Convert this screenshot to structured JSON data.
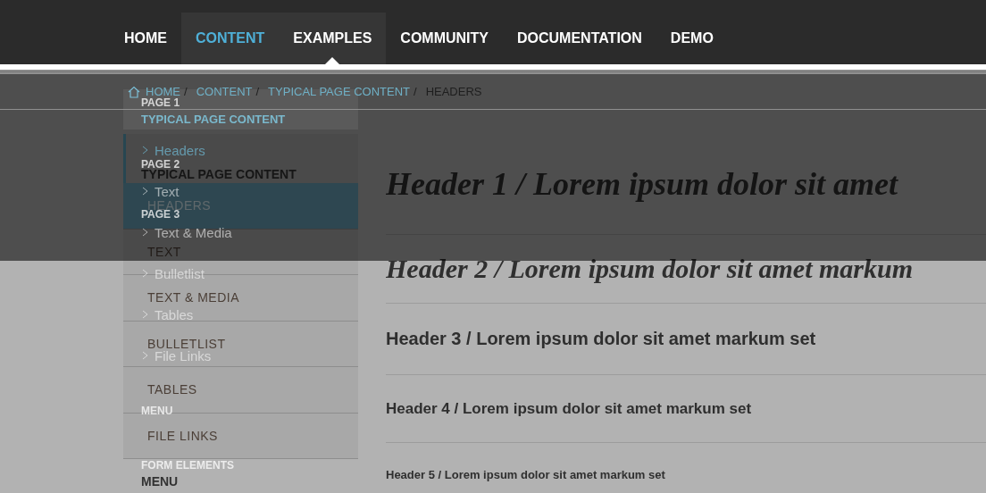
{
  "nav": [
    {
      "label": "HOME",
      "selected": false,
      "expanded": false
    },
    {
      "label": "CONTENT",
      "selected": true,
      "expanded": false
    },
    {
      "label": "EXAMPLES",
      "selected": false,
      "expanded": true
    },
    {
      "label": "COMMUNITY",
      "selected": false,
      "expanded": false
    },
    {
      "label": "DOCUMENTATION",
      "selected": false,
      "expanded": false
    },
    {
      "label": "DEMO",
      "selected": false,
      "expanded": false
    }
  ],
  "breadcrumb": [
    {
      "label": "HOME",
      "selected": false,
      "separator": "/"
    },
    {
      "label": "CONTENT",
      "selected": false,
      "separator": "/"
    },
    {
      "label": "TYPICAL PAGE CONTENT",
      "selected": false,
      "separator": "/"
    },
    {
      "label": "HEADERS",
      "selected": true
    }
  ],
  "sidebar": {
    "title": "TYPICAL PAGE CONTENT",
    "items": [
      {
        "label": "HEADERS",
        "selected": true
      },
      {
        "label": "TEXT",
        "selected": false
      },
      {
        "label": "TEXT & MEDIA",
        "selected": false
      },
      {
        "label": "BULLETLIST",
        "selected": false
      },
      {
        "label": "TABLES",
        "selected": false
      },
      {
        "label": "FILE LINKS",
        "selected": false
      }
    ],
    "footer": "MENU"
  },
  "headers": [
    {
      "kind": "h1",
      "text": "Header 1 / Lorem ipsum dolor sit amet"
    },
    {
      "kind": "h2",
      "text": "Header 2 / Lorem ipsum dolor sit amet markum"
    },
    {
      "kind": "h3",
      "text": "Header 3 / Lorem ipsum dolor sit amet markum set"
    },
    {
      "kind": "h4",
      "text": "Header 4 / Lorem ipsum dolor sit amet markum set"
    },
    {
      "kind": "h5",
      "text": "Header 5 / Lorem ipsum dolor sit amet markum set"
    }
  ],
  "dropdown": {
    "heading": "TYPICAL PAGE CONTENT",
    "labels": [
      "PAGE 1",
      "PAGE 2",
      "PAGE 3",
      "MENU",
      "FORM ELEMENTS"
    ],
    "items": [
      {
        "label": "Headers",
        "selected": true
      },
      {
        "label": "Text",
        "selected": false
      },
      {
        "label": "Text & Media",
        "selected": false
      },
      {
        "label": "Bulletlist",
        "selected": false
      },
      {
        "label": "Tables",
        "selected": false
      },
      {
        "label": "File Links",
        "selected": false
      }
    ]
  }
}
